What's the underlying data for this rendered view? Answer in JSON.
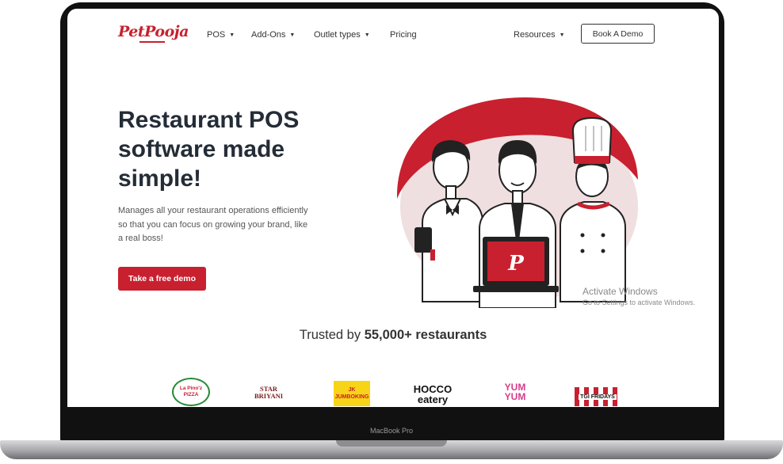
{
  "nav": {
    "logo": "PetPooja",
    "items": [
      {
        "label": "POS",
        "has_dropdown": true
      },
      {
        "label": "Add-Ons",
        "has_dropdown": true
      },
      {
        "label": "Outlet types",
        "has_dropdown": true
      },
      {
        "label": "Pricing",
        "has_dropdown": false
      },
      {
        "label": "Resources",
        "has_dropdown": true
      }
    ],
    "demo_button": "Book A Demo"
  },
  "hero": {
    "title": "Restaurant POS software made simple!",
    "description": "Manages all your restaurant operations efficiently so that you can focus on growing your brand, like a real boss!",
    "cta": "Take a free demo",
    "laptop_letter": "P"
  },
  "trusted": {
    "prefix": "Trusted by",
    "count": "55,000+ restaurants"
  },
  "brands": [
    "La Pino'z PIZZA",
    "STAR BRIYANI",
    "JK JUMBOKING",
    "HOCCO eatery",
    "YUM YUM",
    "TGI FRIDAYS"
  ],
  "watermark": {
    "line1": "Activate Windows",
    "line2": "Go to Settings to activate Windows."
  },
  "device_label": "MacBook Pro",
  "colors": {
    "brand": "#c8202f",
    "heading": "#242c37",
    "blob": "#f0dfe0"
  }
}
